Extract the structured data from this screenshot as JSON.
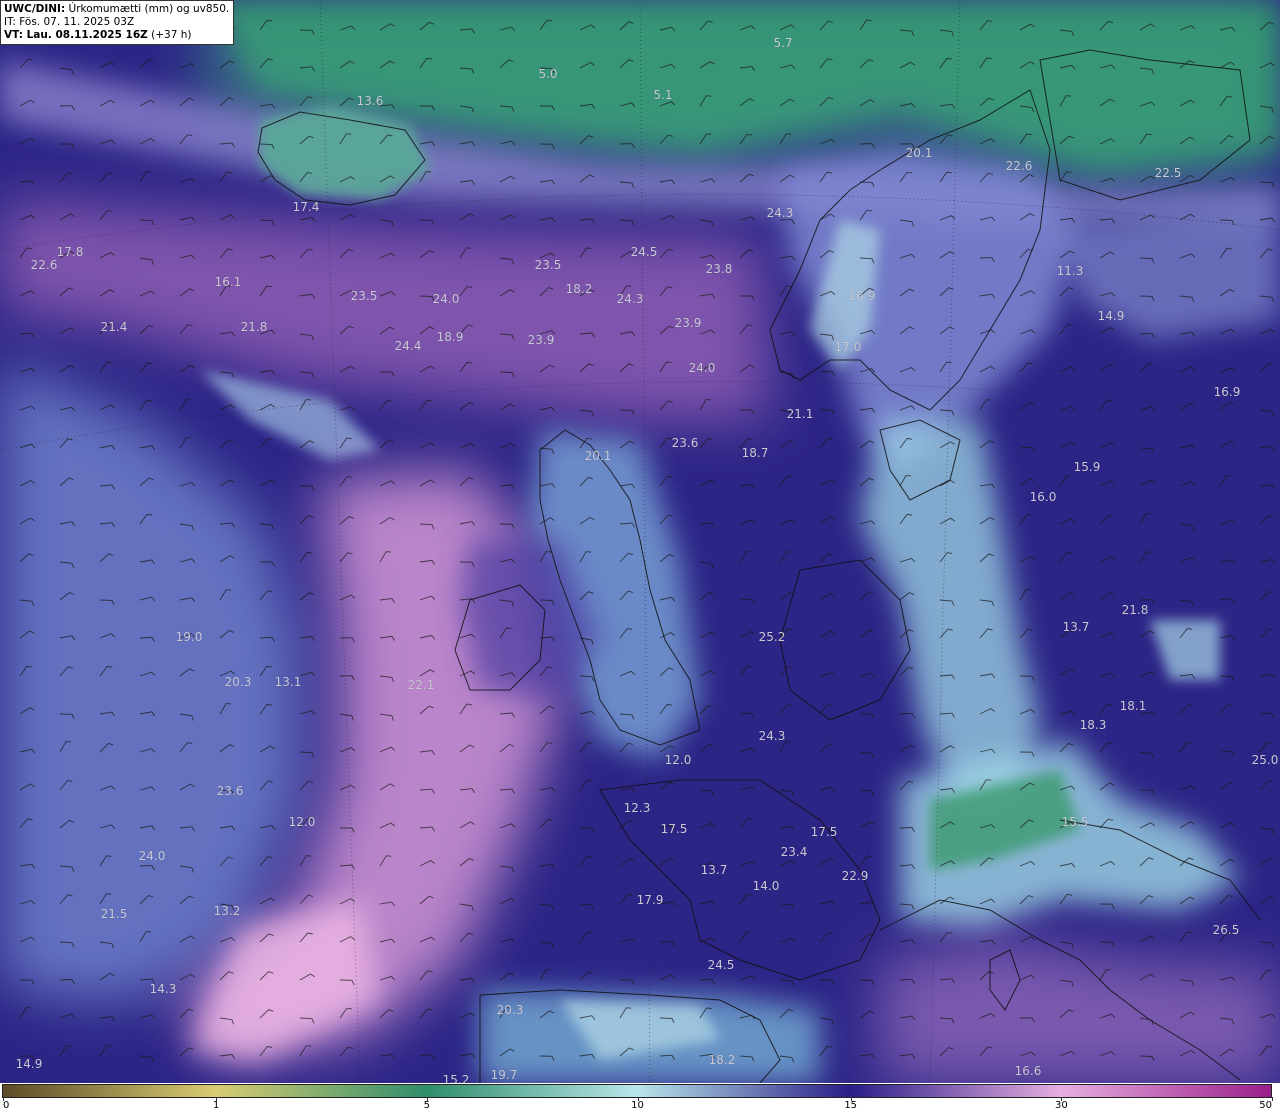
{
  "header": {
    "model": "UWC/DINI:",
    "field": " Úrkomumætti (mm) og uv850.",
    "init_time": "IT: Fös. 07. 11. 2025 03Z",
    "valid_time": "VT: Lau. 08.11.2025 16Z",
    "lead": " (+37 h)"
  },
  "colorbar": {
    "stops": [
      {
        "value": "0",
        "color": "#5e4a28"
      },
      {
        "value": "1",
        "color": "#d8cc72"
      },
      {
        "value": "5",
        "color": "#2f8d6b"
      },
      {
        "value": "10",
        "color": "#b9e6ea"
      },
      {
        "value": "15",
        "color": "#2a1e88"
      },
      {
        "value": "30",
        "color": "#e6aee0"
      },
      {
        "value": "50",
        "color": "#9a1e8a"
      }
    ],
    "ticks": [
      "0",
      "1",
      "5",
      "10",
      "15",
      "30",
      "50"
    ]
  },
  "labels": [
    {
      "text": "5.7"
    },
    {
      "text": "5.0"
    },
    {
      "text": "5.1"
    },
    {
      "text": "13.6"
    },
    {
      "text": "20.1"
    },
    {
      "text": "22.6"
    },
    {
      "text": "22.5"
    },
    {
      "text": "17.4"
    },
    {
      "text": "24.3"
    },
    {
      "text": "17.8"
    },
    {
      "text": "22.6"
    },
    {
      "text": "24.5"
    },
    {
      "text": "23.5"
    },
    {
      "text": "23.8"
    },
    {
      "text": "16.1"
    },
    {
      "text": "23.5"
    },
    {
      "text": "24.0"
    },
    {
      "text": "18.2"
    },
    {
      "text": "24.3"
    },
    {
      "text": "16.9"
    },
    {
      "text": "11.3"
    },
    {
      "text": "21.4"
    },
    {
      "text": "21.8"
    },
    {
      "text": "23.9"
    },
    {
      "text": "14.9"
    },
    {
      "text": "24.4"
    },
    {
      "text": "18.9"
    },
    {
      "text": "23.9"
    },
    {
      "text": "17.0"
    },
    {
      "text": "24.0"
    },
    {
      "text": "16.9"
    },
    {
      "text": "21.1"
    },
    {
      "text": "23.6"
    },
    {
      "text": "18.7"
    },
    {
      "text": "20.1"
    },
    {
      "text": "15.9"
    },
    {
      "text": "16.0"
    },
    {
      "text": "19.0"
    },
    {
      "text": "25.2"
    },
    {
      "text": "21.8"
    },
    {
      "text": "13.7"
    },
    {
      "text": "20.3"
    },
    {
      "text": "13.1"
    },
    {
      "text": "22.1"
    },
    {
      "text": "18.1"
    },
    {
      "text": "18.3"
    },
    {
      "text": "24.3"
    },
    {
      "text": "12.0"
    },
    {
      "text": "25.0"
    },
    {
      "text": "23.6"
    },
    {
      "text": "12.0"
    },
    {
      "text": "12.3"
    },
    {
      "text": "17.5"
    },
    {
      "text": "17.5"
    },
    {
      "text": "15.5"
    },
    {
      "text": "24.0"
    },
    {
      "text": "23.4"
    },
    {
      "text": "13.7"
    },
    {
      "text": "14.0"
    },
    {
      "text": "22.9"
    },
    {
      "text": "21.5"
    },
    {
      "text": "13.2"
    },
    {
      "text": "17.9"
    },
    {
      "text": "26.5"
    },
    {
      "text": "24.5"
    },
    {
      "text": "14.3"
    },
    {
      "text": "20.3"
    },
    {
      "text": "18.2"
    },
    {
      "text": "14.9"
    },
    {
      "text": "19.7"
    },
    {
      "text": "15.2"
    },
    {
      "text": "16.6"
    }
  ]
}
